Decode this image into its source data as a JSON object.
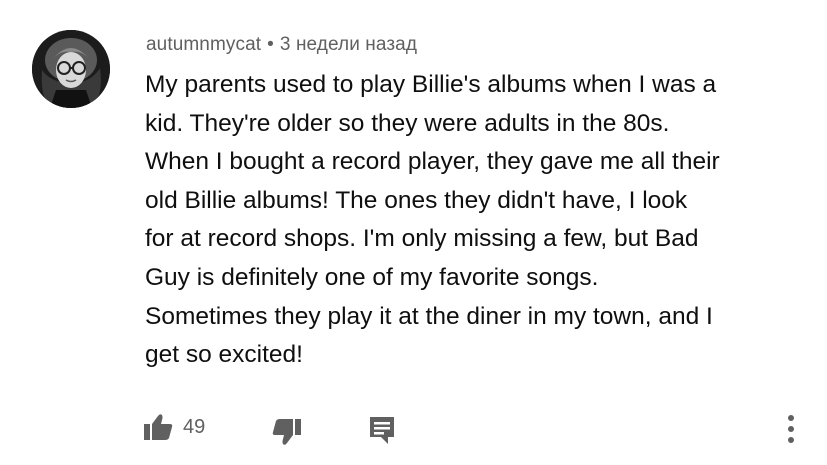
{
  "comment": {
    "author": "autumnmycat",
    "separator": "•",
    "time": "3 недели назад",
    "text_lines": [
      "My parents used to play Billie's albums when I was a",
      "kid. They're older so they were adults in the 80s.",
      "When I bought a record player, they gave me all their",
      "old Billie albums! The ones they didn't have, I look",
      "for at record shops. I'm only missing a few, but Bad",
      "Guy is definitely one of my favorite songs.",
      "Sometimes they play it at the diner in my town, and I",
      "get so excited!"
    ]
  },
  "actions": {
    "like_count": "49",
    "icons": {
      "like": "thumbs-up-icon",
      "dislike": "thumbs-down-icon",
      "reply": "reply-comment-icon",
      "more": "more-vertical-icon"
    }
  },
  "colors": {
    "text_primary": "#0f0f0f",
    "text_secondary": "#606060",
    "icon": "#606060",
    "background": "#ffffff"
  }
}
